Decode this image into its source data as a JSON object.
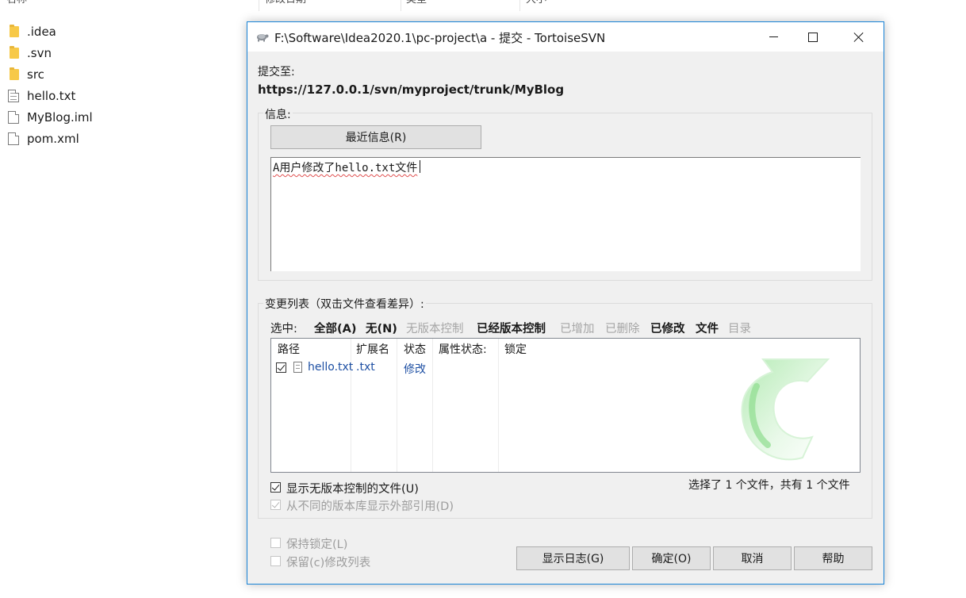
{
  "explorer": {
    "columns": [
      "名称",
      "修改日期",
      "类型",
      "大小"
    ],
    "files": [
      {
        "name": ".idea",
        "type": "folder"
      },
      {
        "name": ".svn",
        "type": "folder"
      },
      {
        "name": "src",
        "type": "folder"
      },
      {
        "name": "hello.txt",
        "type": "text-file"
      },
      {
        "name": "MyBlog.iml",
        "type": "file"
      },
      {
        "name": "pom.xml",
        "type": "file"
      }
    ]
  },
  "dialog": {
    "title": "F:\\Software\\Idea2020.1\\pc-project\\a - 提交 - TortoiseSVN",
    "commit_to_label": "提交至:",
    "url": "https://127.0.0.1/svn/myproject/trunk/MyBlog",
    "message_group": {
      "title": "信息:",
      "recent_button": "最近信息(R)",
      "message": "A用户修改了hello.txt文件"
    },
    "changes_group": {
      "title": "变更列表（双击文件查看差异）:",
      "select_label": "选中:",
      "filters": [
        {
          "label": "全部(A)",
          "enabled": true
        },
        {
          "label": "无(N)",
          "enabled": true
        },
        {
          "label": "无版本控制",
          "enabled": false
        },
        {
          "label": "已经版本控制",
          "enabled": true
        },
        {
          "label": "已增加",
          "enabled": false
        },
        {
          "label": "已删除",
          "enabled": false
        },
        {
          "label": "已修改",
          "enabled": true
        },
        {
          "label": "文件",
          "enabled": true
        },
        {
          "label": "目录",
          "enabled": false
        }
      ],
      "columns": [
        "路径",
        "扩展名",
        "状态",
        "属性状态:",
        "锁定"
      ],
      "rows": [
        {
          "checked": true,
          "path": "hello.txt",
          "ext": ".txt",
          "status": "修改",
          "prop_status": "",
          "lock": ""
        }
      ],
      "show_unversioned": {
        "label": "显示无版本控制的文件(U)",
        "checked": true
      },
      "show_externals": {
        "label": "从不同的版本库显示外部引用(D)",
        "checked": true,
        "disabled": true
      },
      "summary": "选择了 1 个文件，共有 1 个文件"
    },
    "keep_locks": {
      "label": "保持锁定(L)",
      "checked": false
    },
    "keep_changelists": {
      "label": "保留(c)修改列表",
      "checked": false
    },
    "buttons": {
      "show_log": "显示日志(G)",
      "ok": "确定(O)",
      "cancel": "取消",
      "help": "帮助"
    },
    "colors": {
      "accent_border": "#1883d7",
      "link_text": "#1d4fa3",
      "watermark_green": "#5ccc5c"
    }
  }
}
